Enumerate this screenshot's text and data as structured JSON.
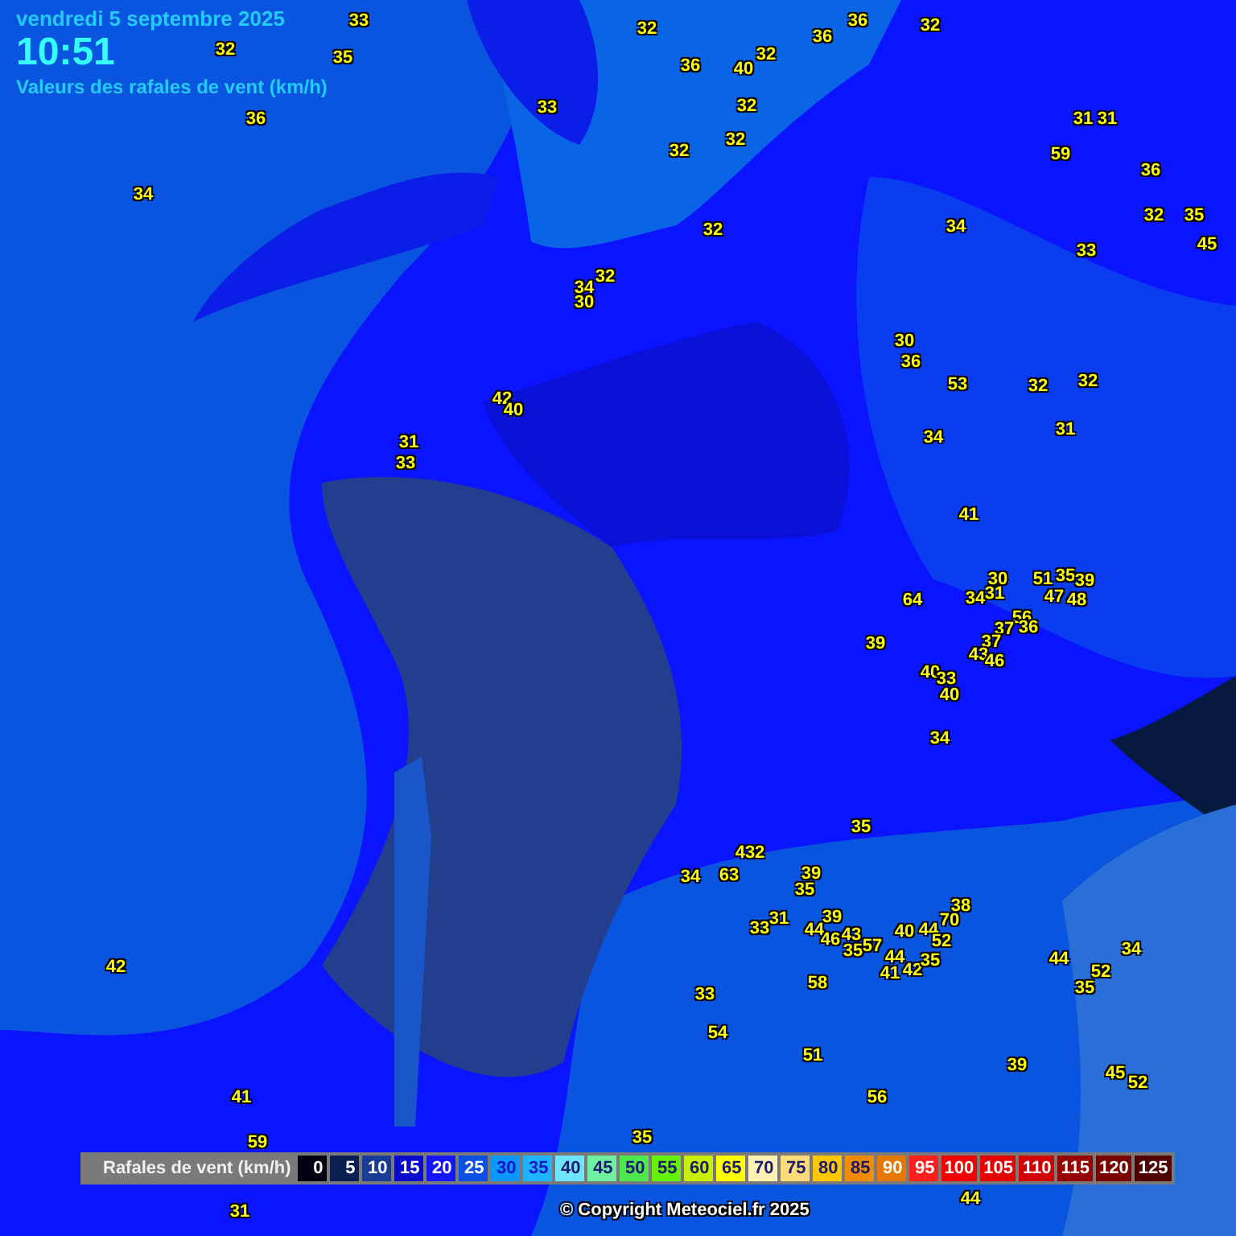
{
  "header": {
    "date": "vendredi 5 septembre 2025",
    "time": "10:51",
    "subtitle": "Valeurs des rafales de vent (km/h)"
  },
  "readings": [
    "33",
    "32",
    "36",
    "36",
    "32",
    "32",
    "35",
    "32",
    "36",
    "40",
    "36",
    "33",
    "32",
    "31",
    "31",
    "32",
    "32",
    "59",
    "36",
    "34",
    "32",
    "34",
    "32",
    "35",
    "45",
    "33",
    "32",
    "34",
    "30",
    "30",
    "36",
    "53",
    "32",
    "32",
    "42",
    "40",
    "34",
    "31",
    "31",
    "33",
    "41",
    "30",
    "51",
    "35",
    "39",
    "34",
    "31",
    "64",
    "47",
    "48",
    "56",
    "37",
    "36",
    "37",
    "43",
    "46",
    "39",
    "40",
    "33",
    "40",
    "34",
    "35",
    "432",
    "34",
    "63",
    "39",
    "35",
    "38",
    "33",
    "31",
    "39",
    "44",
    "46",
    "43",
    "35",
    "57",
    "40",
    "44",
    "70",
    "52",
    "44",
    "41",
    "42",
    "35",
    "42",
    "44",
    "52",
    "34",
    "58",
    "35",
    "33",
    "54",
    "51",
    "39",
    "45",
    "52",
    "56",
    "41",
    "59",
    "35",
    "31",
    "44"
  ],
  "legend": {
    "title": "Rafales de vent (km/h)",
    "items": [
      {
        "label": "0",
        "color": "#000010"
      },
      {
        "label": "5",
        "color": "#0a2050"
      },
      {
        "label": "10",
        "color": "#183c96"
      },
      {
        "label": "15",
        "color": "#0a0acc"
      },
      {
        "label": "20",
        "color": "#1414ff"
      },
      {
        "label": "25",
        "color": "#0a50e6"
      },
      {
        "label": "30",
        "color": "#0a96ff"
      },
      {
        "label": "35",
        "color": "#1eb4ff"
      },
      {
        "label": "40",
        "color": "#6ee6ff"
      },
      {
        "label": "45",
        "color": "#6ef0a0"
      },
      {
        "label": "50",
        "color": "#50e650"
      },
      {
        "label": "55",
        "color": "#64f000"
      },
      {
        "label": "60",
        "color": "#c8f000"
      },
      {
        "label": "65",
        "color": "#ffff00"
      },
      {
        "label": "70",
        "color": "#fff0b4"
      },
      {
        "label": "75",
        "color": "#ffdc78"
      },
      {
        "label": "80",
        "color": "#ffc800"
      },
      {
        "label": "85",
        "color": "#f08c00"
      },
      {
        "label": "90",
        "color": "#e67800"
      },
      {
        "label": "95",
        "color": "#ff1e1e"
      },
      {
        "label": "100",
        "color": "#f00000"
      },
      {
        "label": "105",
        "color": "#e60000"
      },
      {
        "label": "110",
        "color": "#d20000"
      },
      {
        "label": "115",
        "color": "#960000"
      },
      {
        "label": "120",
        "color": "#780000"
      },
      {
        "label": "125",
        "color": "#500000"
      }
    ]
  },
  "copyright": "© Copyright Meteociel.fr 2025"
}
